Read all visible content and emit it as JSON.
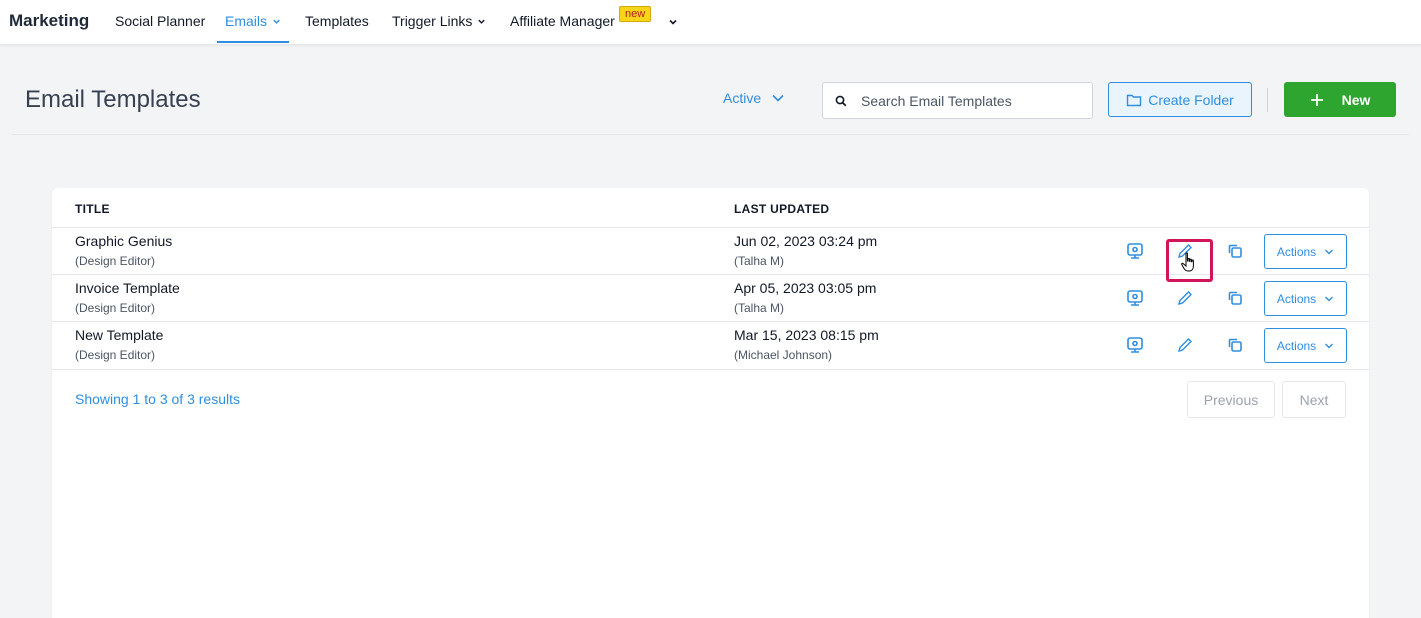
{
  "nav": {
    "brand": "Marketing",
    "items": [
      {
        "label": "Social Planner"
      },
      {
        "label": "Emails"
      },
      {
        "label": "Templates"
      },
      {
        "label": "Trigger Links"
      },
      {
        "label": "Affiliate Manager"
      }
    ],
    "new_badge": "new"
  },
  "header": {
    "title": "Email Templates",
    "filter": "Active",
    "search_placeholder": "Search Email Templates",
    "create_folder": "Create Folder",
    "new_button": "New"
  },
  "table": {
    "columns": [
      "TITLE",
      "LAST UPDATED"
    ],
    "rows": [
      {
        "title": "Graphic Genius",
        "editor": "(Design Editor)",
        "updated": "Jun 02, 2023 03:24 pm",
        "by": "(Talha M)",
        "actions": "Actions"
      },
      {
        "title": "Invoice Template",
        "editor": "(Design Editor)",
        "updated": "Apr 05, 2023 03:05 pm",
        "by": "(Talha M)",
        "actions": "Actions"
      },
      {
        "title": "New Template",
        "editor": "(Design Editor)",
        "updated": "Mar 15, 2023 08:15 pm",
        "by": "(Michael Johnson)",
        "actions": "Actions"
      }
    ],
    "showing": "Showing 1 to 3 of 3 results",
    "prev": "Previous",
    "next": "Next"
  },
  "colors": {
    "accent": "#2f8ee0",
    "primary_green": "#2ea52f",
    "highlight": "#d1155a"
  },
  "icons": [
    "search-icon",
    "folder-icon",
    "plus-icon",
    "preview-icon",
    "pencil-icon",
    "copy-icon",
    "chevron-down-icon",
    "hand-cursor-icon"
  ]
}
